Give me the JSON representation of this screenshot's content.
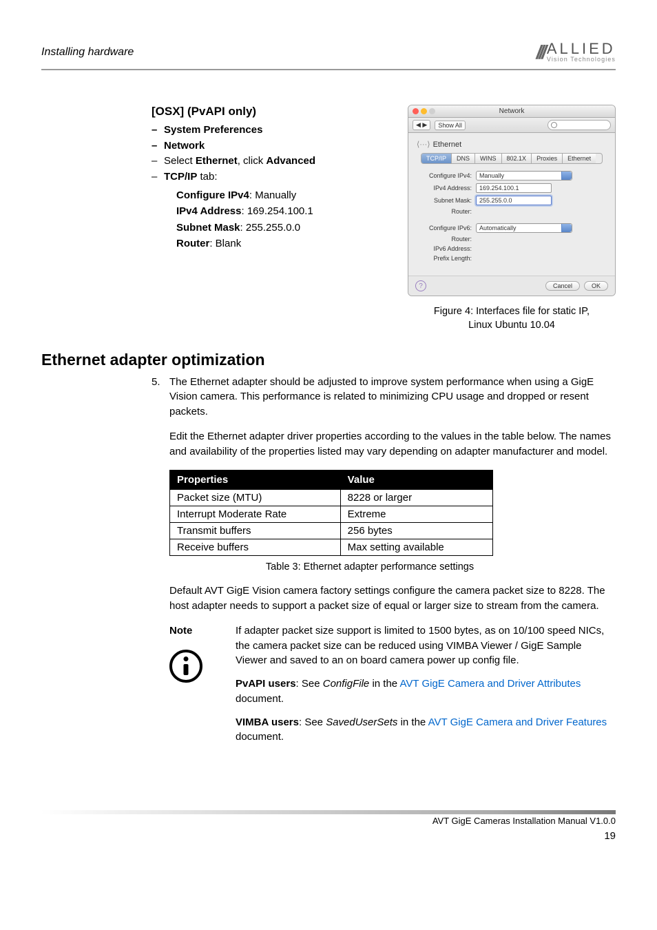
{
  "header": {
    "section": "Installing hardware",
    "logo_main": "ALLIED",
    "logo_sub": "Vision Technologies"
  },
  "osx": {
    "heading": "[OSX] (PvAPI only)",
    "items": [
      {
        "type": "bold-dash",
        "text": "System Preferences"
      },
      {
        "type": "bold-dash",
        "text": "Network"
      }
    ],
    "select_line_pre": "Select ",
    "select_line_bold1": "Ethernet",
    "select_line_mid": ", click ",
    "select_line_bold2": "Advanced",
    "tcpip_bold": "TCP/IP",
    "tcpip_tail": " tab:",
    "conf_ipv4_label": "Configure IPv4",
    "conf_ipv4_val": ": Manually",
    "ipv4_addr_label": "IPv4 Address",
    "ipv4_addr_val": ": 169.254.100.1",
    "subnet_label": "Subnet Mask",
    "subnet_val": ": 255.255.0.0",
    "router_label": "Router",
    "router_val": ": Blank"
  },
  "screenshot": {
    "title": "Network",
    "toolbar_btn1": "◀ ▶",
    "toolbar_btn2": "Show All",
    "eth_label": "Ethernet",
    "tabs": [
      "TCP/IP",
      "DNS",
      "WINS",
      "802.1X",
      "Proxies",
      "Ethernet"
    ],
    "rows": {
      "conf4_label": "Configure IPv4:",
      "conf4_val": "Manually",
      "ipv4_label": "IPv4 Address:",
      "ipv4_val": "169.254.100.1",
      "sub_label": "Subnet Mask:",
      "sub_val": "255.255.0.0",
      "router_label": "Router:",
      "conf6_label": "Configure IPv6:",
      "conf6_val": "Automatically",
      "router6_label": "Router:",
      "ipv6_label": "IPv6 Address:",
      "prefix_label": "Prefix Length:"
    },
    "cancel": "Cancel",
    "ok": "OK"
  },
  "figure_caption_l1": "Figure 4: Interfaces file for static IP,",
  "figure_caption_l2": "Linux Ubuntu 10.04",
  "h2": "Ethernet adapter optimization",
  "step5_num": "5.",
  "step5_text": "The Ethernet adapter should be adjusted to improve system performance when using a GigE Vision camera. This performance is related to minimizing CPU usage and dropped or resent packets.",
  "para1": "Edit the Ethernet adapter driver properties according to the values in the table below. The names and availability of the properties listed may vary depending on adapter manufacturer and model.",
  "table": {
    "head_prop": "Properties",
    "head_val": "Value",
    "rows": [
      {
        "p": "Packet size (MTU)",
        "v": "8228 or larger"
      },
      {
        "p": "Interrupt Moderate Rate",
        "v": "Extreme"
      },
      {
        "p": "Transmit buffers",
        "v": "256 bytes"
      },
      {
        "p": "Receive buffers",
        "v": "Max setting available"
      }
    ]
  },
  "table_caption": "Table 3: Ethernet adapter performance settings",
  "para2": "Default AVT GigE Vision camera factory settings configure the camera packet size to 8228. The host adapter needs to support a packet size of equal or larger size to stream from the camera.",
  "note": {
    "label": "Note",
    "p1": "If adapter packet size support is limited to 1500 bytes, as on 10/100 speed NICs, the camera packet size can be reduced using VIMBA Viewer / GigE Sample Viewer and saved to an on board camera power up config file.",
    "p2_bold": "PvAPI users",
    "p2_mid": ": See ",
    "p2_ital": "ConfigFile",
    "p2_in": " in the ",
    "p2_link": "AVT GigE Camera and Driver Attributes",
    "p2_end": " document.",
    "p3_bold": "VIMBA users",
    "p3_mid": ": See ",
    "p3_ital": "SavedUserSets",
    "p3_in": " in the ",
    "p3_link": "AVT GigE Camera and Driver Features",
    "p3_end": " document."
  },
  "footer": {
    "text": "AVT GigE Cameras Installation Manual V1.0.0",
    "page": "19"
  }
}
